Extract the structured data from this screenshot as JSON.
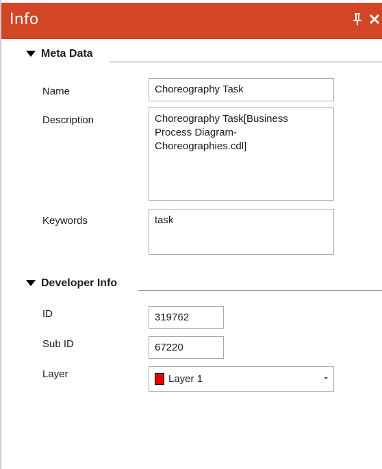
{
  "panel": {
    "title": "Info",
    "accent_color": "#d24625",
    "pin_icon": "pin-icon",
    "close_icon": "close-icon"
  },
  "meta_data": {
    "header": "Meta Data",
    "name_label": "Name",
    "name_value": "Choreography Task",
    "description_label": "Description",
    "description_value": "Choreography Task[Business\nProcess Diagram-\nChoreographies.cdl]",
    "keywords_label": "Keywords",
    "keywords_value": "task"
  },
  "developer_info": {
    "header": "Developer Info",
    "id_label": "ID",
    "id_value": "319762",
    "sub_id_label": "Sub ID",
    "sub_id_value": "67220",
    "layer_label": "Layer",
    "layer_value": "Layer 1",
    "layer_color": "#e60000"
  }
}
